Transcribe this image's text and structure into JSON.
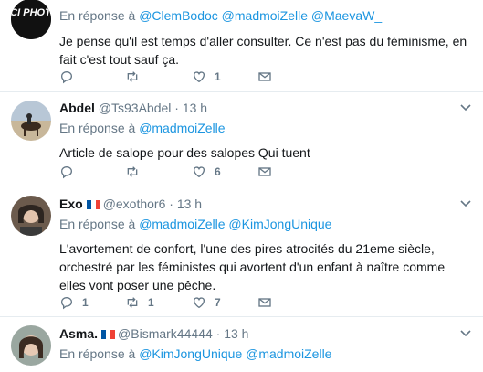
{
  "reply_prefix": "En réponse à",
  "tweets": [
    {
      "avatar": "pci-photo-logo",
      "logo_text": "PCI PHOTO",
      "name": "",
      "handle": "",
      "time": "",
      "reply_to": "@ClemBodoc @madmoiZelle @MaevaW_",
      "text": "Je pense qu'il est temps d'aller consulter. Ce n'est pas du féminisme, en fait c'est tout sauf ça.",
      "replies": "",
      "retweets": "",
      "likes": "1"
    },
    {
      "avatar": "horse-rider-photo",
      "name": "Abdel",
      "handle": "@Ts93Abdel",
      "time": "13 h",
      "reply_to": "@madmoiZelle",
      "text": "Article de salope pour des salopes Qui tuent",
      "replies": "",
      "retweets": "",
      "likes": "6"
    },
    {
      "avatar": "woman-photo",
      "name": "Exo",
      "flag": "france-flag",
      "handle": "@exothor6",
      "time": "13 h",
      "reply_to": "@madmoiZelle @KimJongUnique",
      "text": "L'avortement de confort, l'une des pires atrocités du 21eme siècle, orchestré par les féministes qui avortent d'un enfant à naître comme elles vont poser une pêche.",
      "replies": "1",
      "retweets": "1",
      "likes": "7"
    },
    {
      "avatar": "woman-photo-2",
      "name": "Asma.",
      "flag": "france-flag",
      "handle": "@Bismark44444",
      "time": "13 h",
      "reply_to": "@KimJongUnique @madmoiZelle",
      "text": ""
    }
  ],
  "separator": " · "
}
